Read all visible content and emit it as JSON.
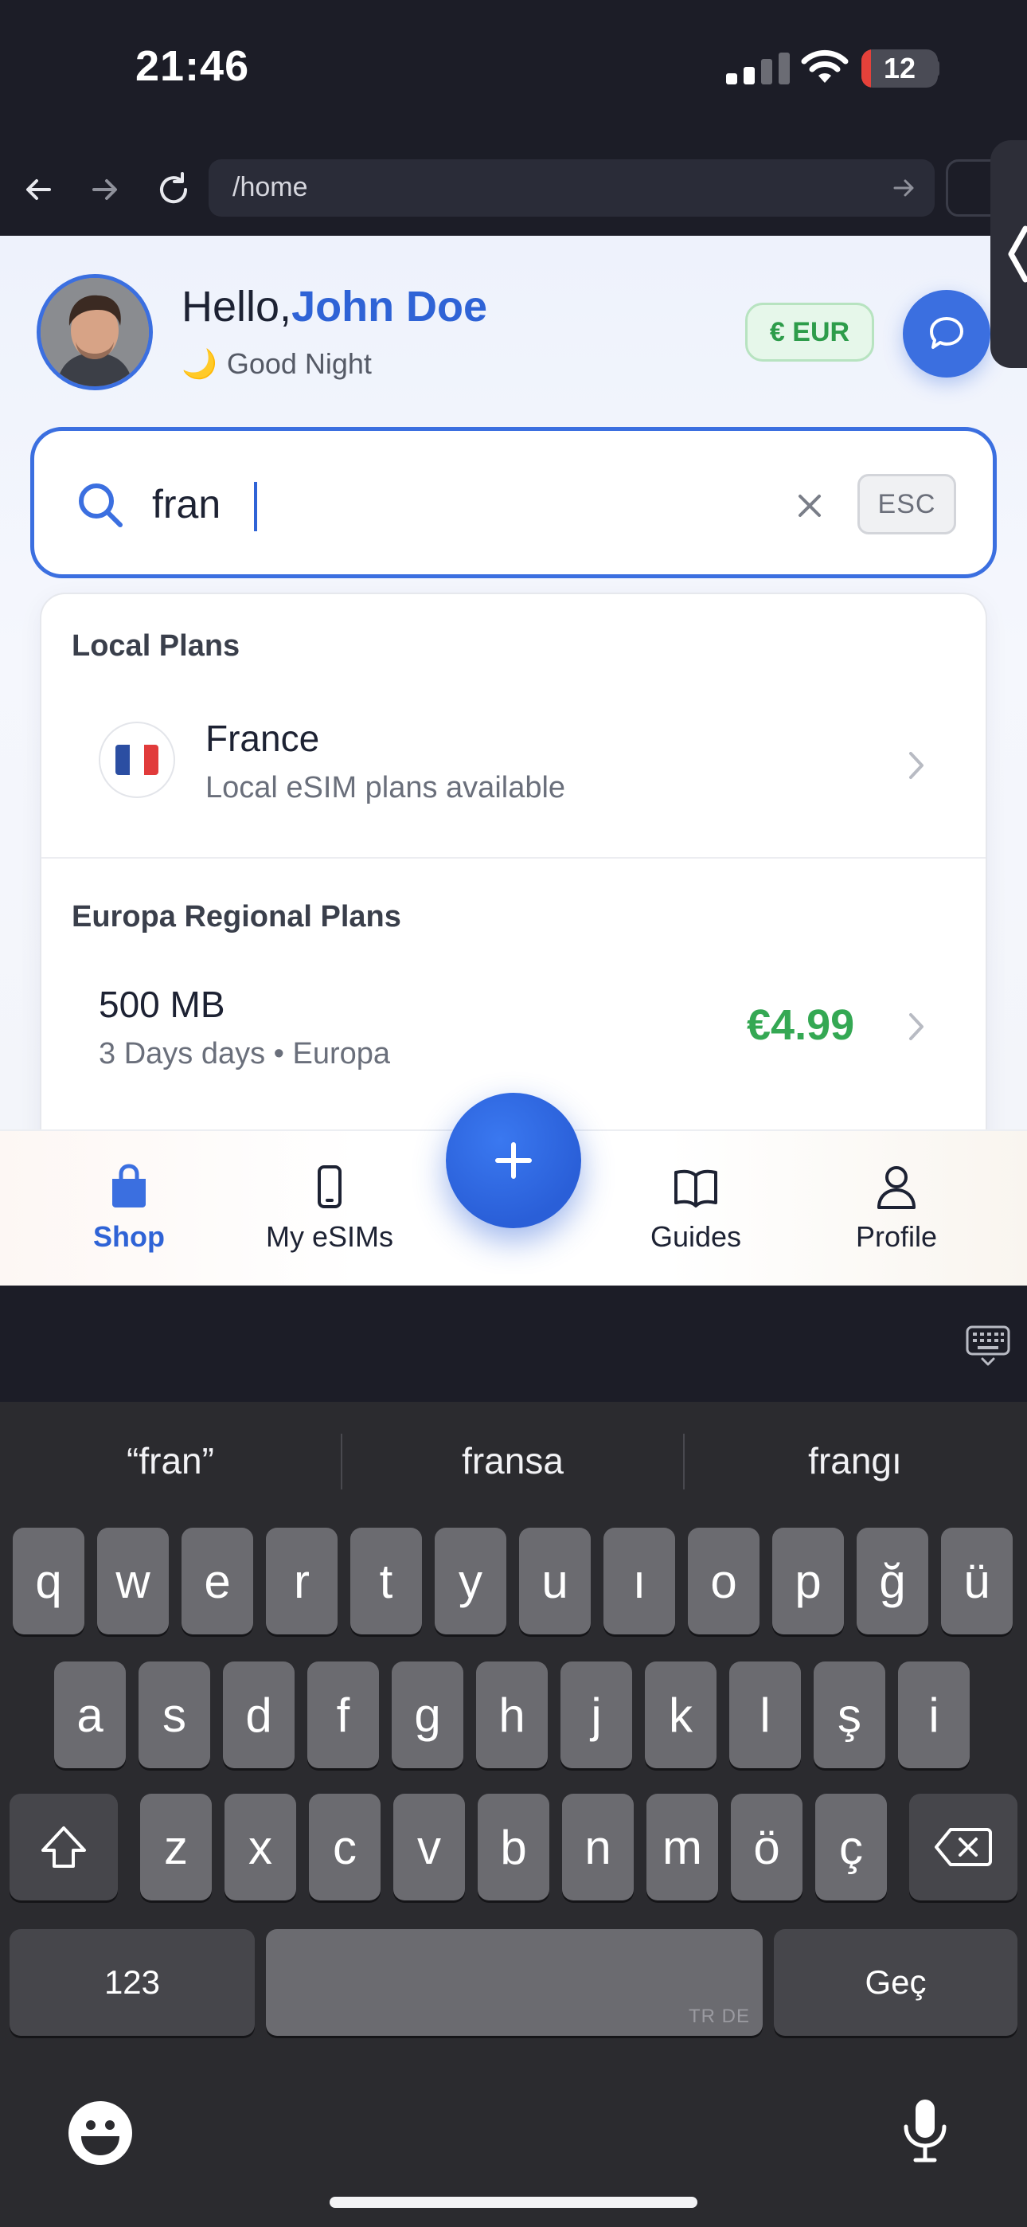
{
  "status_bar": {
    "time": "21:46",
    "battery_level": "12",
    "battery_fraction": 0.12,
    "battery_color": "#e5413a",
    "icons": [
      "signal-icon",
      "wifi-icon",
      "battery-icon"
    ]
  },
  "browser": {
    "url": "/home",
    "icons": [
      "back-arrow-icon",
      "forward-arrow-icon",
      "reload-icon",
      "go-arrow-icon"
    ]
  },
  "header": {
    "greeting_prefix": "Hello,",
    "user_name": "John Doe",
    "greeting_emoji": "🌙",
    "subtitle": "Good Night",
    "currency_label": "€ EUR",
    "accent_color": "#3b6fe0"
  },
  "search": {
    "value": "fran",
    "esc_label": "ESC"
  },
  "results": {
    "local_section_title": "Local Plans",
    "local_item": {
      "title": "France",
      "subtitle": "Local eSIM plans available",
      "flag_colors": [
        "#2b4ea2",
        "#ffffff",
        "#e13b3b"
      ]
    },
    "regional_section_title": "Europa Regional Plans",
    "regional_item": {
      "title": "500 MB",
      "subtitle": "3 Days days • Europa",
      "price": "€4.99",
      "price_color": "#34a853"
    }
  },
  "bottom_nav": {
    "items": [
      {
        "label": "Shop",
        "icon": "shopping-bag-icon",
        "active": true
      },
      {
        "label": "My eSIMs",
        "icon": "phone-icon",
        "active": false
      },
      {
        "label": "Guides",
        "icon": "book-icon",
        "active": false
      },
      {
        "label": "Profile",
        "icon": "user-icon",
        "active": false
      }
    ],
    "fab_icon": "plus-icon"
  },
  "keyboard": {
    "suggestions": [
      "“fran”",
      "fransa",
      "frangı"
    ],
    "row1": [
      "q",
      "w",
      "e",
      "r",
      "t",
      "y",
      "u",
      "ı",
      "o",
      "p",
      "ğ",
      "ü"
    ],
    "row2": [
      "a",
      "s",
      "d",
      "f",
      "g",
      "h",
      "j",
      "k",
      "l",
      "ş",
      "i"
    ],
    "row3": [
      "z",
      "x",
      "c",
      "v",
      "b",
      "n",
      "m",
      "ö",
      "ç"
    ],
    "numbers_key": "123",
    "space_language_tag": "TR DE",
    "return_key": "Geç"
  }
}
